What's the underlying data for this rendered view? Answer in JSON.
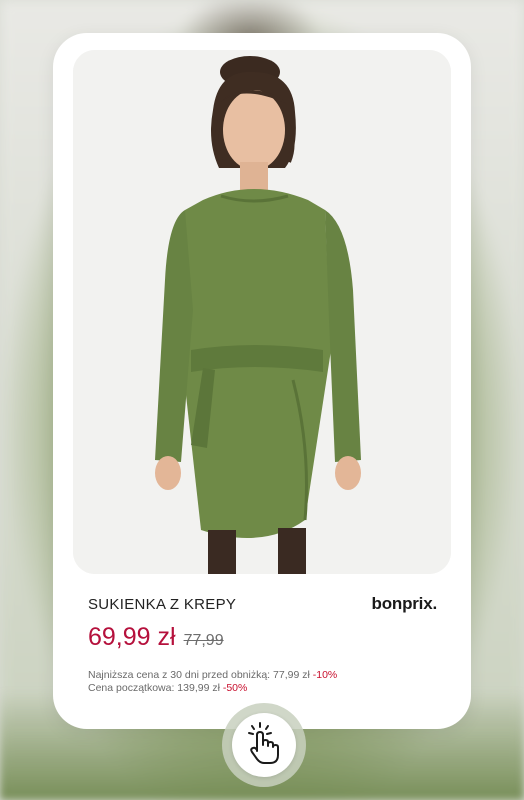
{
  "product": {
    "title": "SUKIENKA Z KREPY",
    "brand": "bonprix.",
    "price": "69,99 zł",
    "old_price": "77,99",
    "lowest_price_label": "Najniższa cena z 30 dni  przed obniżką: 77,99 zł",
    "lowest_price_discount": "-10%",
    "initial_price_label": "Cena początkowa: 139,99 zł",
    "initial_price_discount": "-50%"
  },
  "colors": {
    "price": "#b5103c",
    "discount": "#c8102e",
    "dress": "#6f8a47"
  },
  "icons": {
    "tap": "tap-hand-icon"
  }
}
